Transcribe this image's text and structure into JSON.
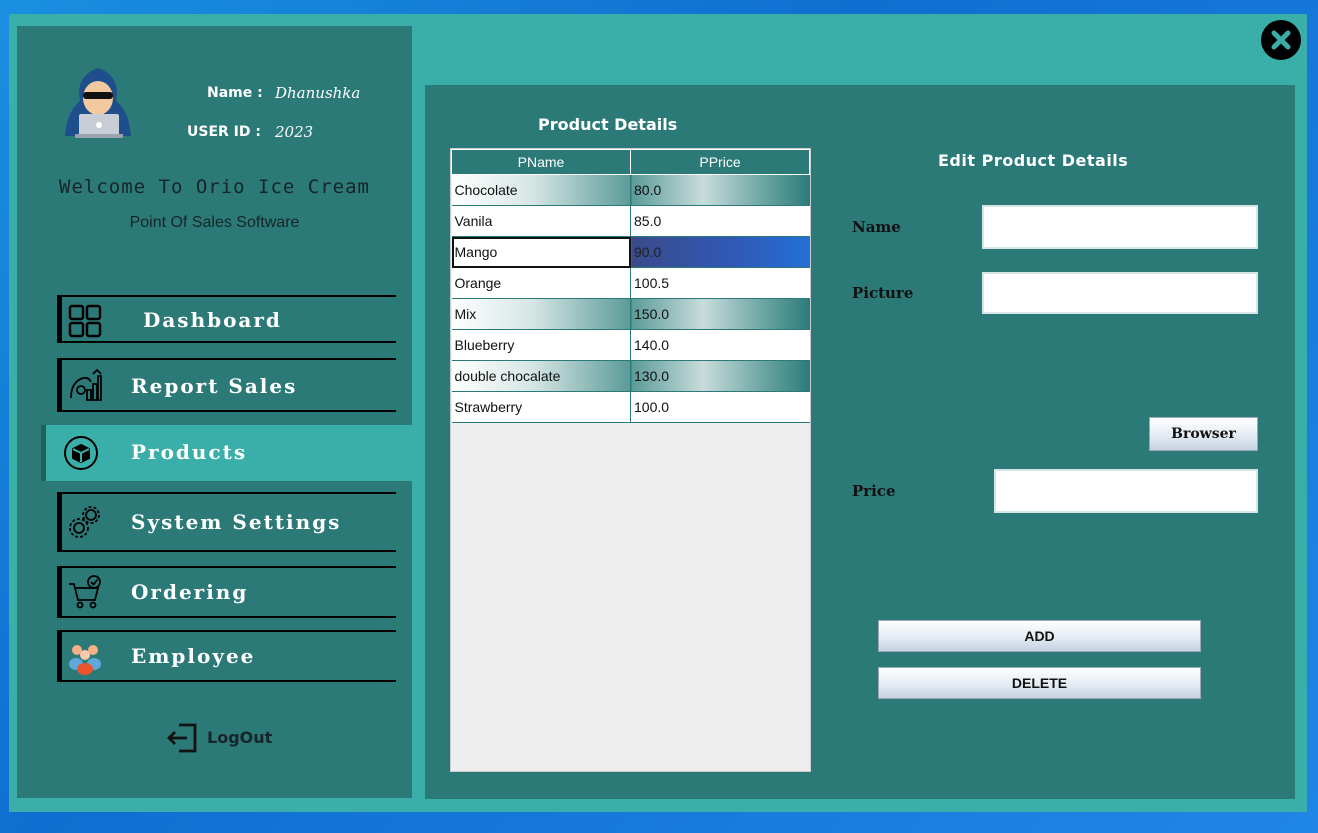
{
  "user": {
    "name_label": "Name :",
    "name_value": "Dhanushka",
    "id_label": "USER ID :",
    "id_value": "2023"
  },
  "welcome": "Welcome To Orio Ice Cream",
  "subtitle": "Point Of Sales Software",
  "nav": [
    {
      "label": "Dashboard",
      "icon": "dashboard-grid-icon"
    },
    {
      "label": "Report Sales",
      "icon": "report-sales-icon"
    },
    {
      "label": "Products",
      "icon": "product-box-icon"
    },
    {
      "label": "System Settings",
      "icon": "gears-icon"
    },
    {
      "label": "Ordering",
      "icon": "shopping-cart-icon"
    },
    {
      "label": "Employee",
      "icon": "employees-icon"
    }
  ],
  "logout": "LogOut",
  "product_details": {
    "title": "Product Details",
    "columns": [
      "PName",
      "PPrice"
    ],
    "rows": [
      [
        "Chocolate",
        "80.0"
      ],
      [
        "Vanila",
        "85.0"
      ],
      [
        "Mango",
        "90.0"
      ],
      [
        "Orange",
        "100.5"
      ],
      [
        "Mix",
        "150.0"
      ],
      [
        "Blueberry",
        "140.0"
      ],
      [
        "double chocalate",
        "130.0"
      ],
      [
        "Strawberry",
        "100.0"
      ]
    ]
  },
  "edit": {
    "title": "Edit Product Details",
    "name_label": "Name",
    "name_value": "",
    "picture_label": "Picture",
    "picture_value": "",
    "browse_label": "Browser",
    "price_label": "Price",
    "price_value": "",
    "add_label": "ADD",
    "delete_label": "DELETE"
  }
}
